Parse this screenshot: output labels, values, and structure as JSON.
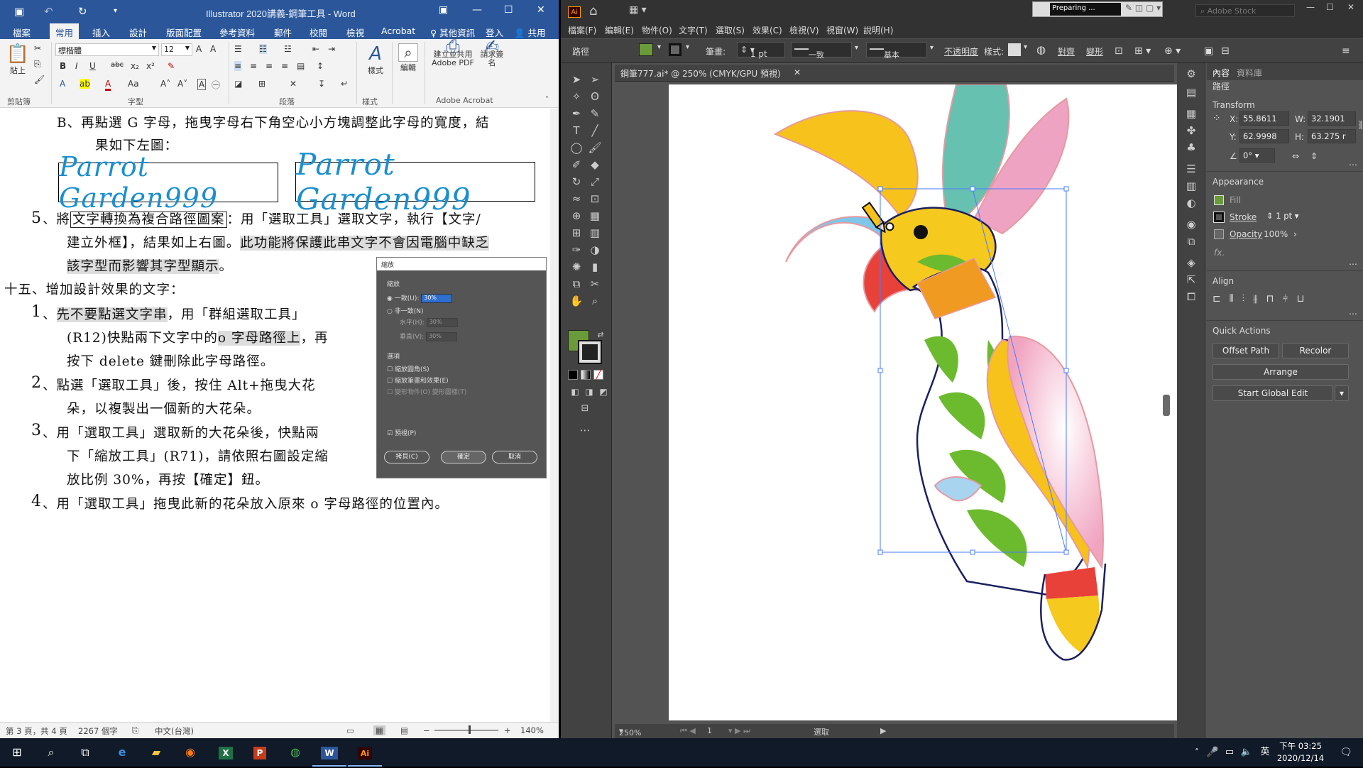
{
  "word": {
    "title": "Illustrator 2020講義-鋼筆工具 - Word",
    "tabs": [
      "檔案",
      "常用",
      "插入",
      "設計",
      "版面配置",
      "參考資料",
      "郵件",
      "校閱",
      "檢視",
      "Acrobat"
    ],
    "tell_me": "♀ 其他資訊",
    "signin": "登入",
    "share": "共用",
    "ribbon": {
      "font_name": "標楷體",
      "font_size": "12",
      "paste_label": "貼上",
      "styles_label": "樣式",
      "edit_label": "編輯",
      "pdf_label": "建立並共用 Adobe PDF",
      "sign_label": "請求簽名",
      "groups": [
        "剪貼簿",
        "字型",
        "段落",
        "樣式",
        "Adobe Acrobat"
      ]
    },
    "doc": {
      "line_b1": "B、再點選 G 字母，拖曳字母右下角空心小方塊調整此字母的寬度，結",
      "line_b2": "果如下左圖：",
      "parrot_text": "Parrot Garden999",
      "item5_num": "5",
      "item5_a": "、將",
      "item5_box": "文字轉換為複合路徑圖案",
      "item5_b": "：用「選取工具」選取文字，執行【文字/",
      "item5_l2a": "建立外框】，結果如上右圖。",
      "item5_l2b": "此功能將保護此串文字不會因電腦中缺乏",
      "item5_l3": "該字型而影響其字型顯示",
      "item5_l3end": "。",
      "sec15": "十五、增加設計效果的文字：",
      "i1_num": "1",
      "i1_a": "、",
      "i1_hl": "先不要點選文字串",
      "i1_b": "，用「群組選取工具」",
      "i1_l2a": "(R12)快點兩下文字中的",
      "i1_l2hl": "o 字母路徑上",
      "i1_l2b": "，再",
      "i1_l3": "按下 delete 鍵刪除此字母路徑。",
      "i2_num": "2",
      "i2_l1": "、點選「選取工具」後，按住 Alt+拖曳大花",
      "i2_l2": "朵，以複製出一個新的大花朵。",
      "i3_num": "3",
      "i3_l1": "、用「選取工具」選取新的大花朵後，快點兩",
      "i3_l2": "下「縮放工具」(R71)，請依照右圖設定縮",
      "i3_l3": "放比例 30%，再按【確定】鈕。",
      "i4_num": "4",
      "i4_l1": "、用「選取工具」拖曳此新的花朵放入原來 o 字母路徑的位置內。"
    },
    "dialog": {
      "title": "縮放",
      "group1": "縮放",
      "uniform": "一致(U):",
      "uniform_val": "30%",
      "nonuniform": "非一致(N)",
      "horiz": "水平(H):",
      "horiz_val": "30%",
      "vert": "垂直(V):",
      "vert_val": "30%",
      "group2": "選項",
      "opt1": "縮放圓角(S)",
      "opt2": "縮放筆畫和效果(E)",
      "opt3": "變形物件(O)   變形圖樣(T)",
      "preview": "預視(P)",
      "copy_btn": "拷貝(C)",
      "ok_btn": "確定",
      "cancel_btn": "取消"
    },
    "status": {
      "page": "第 3 頁，共 4 頁",
      "words": "2267 個字",
      "lang": "中文(台灣)",
      "zoom": "140%"
    }
  },
  "ai": {
    "search_placeholder": "Adobe Stock",
    "preparing": "Preparing ...",
    "menu": [
      "檔案(F)",
      "編輯(E)",
      "物件(O)",
      "文字(T)",
      "選取(S)",
      "效果(C)",
      "檢視(V)",
      "視窗(W)",
      "說明(H)"
    ],
    "control": {
      "path": "路徑",
      "stroke_label": "筆畫:",
      "stroke_val": "1 pt",
      "profile1": "一致",
      "profile2": "基本",
      "opacity": "不透明度",
      "style": "樣式:",
      "align": "對齊",
      "transform": "變形"
    },
    "doc_tab": "鋼筆777.ai* @ 250% (CMYK/GPU 預視)",
    "bottom": {
      "zoom": "250%",
      "page": "1",
      "mode": "選取"
    },
    "props": {
      "tab1": "內容",
      "tab2": "資料庫",
      "selection": "路徑",
      "transform": "Transform",
      "x_label": "X:",
      "x": "55.8611",
      "y_label": "Y:",
      "y": "62.9998",
      "w_label": "W:",
      "w": "32.1901",
      "h_label": "H:",
      "h": "63.275 r",
      "angle": "0°",
      "appearance": "Appearance",
      "fill": "Fill",
      "stroke": "Stroke",
      "stroke_val": "1 pt",
      "opacity": "Opacity",
      "opacity_val": "100%",
      "fx": "fx.",
      "align": "Align",
      "quick_actions": "Quick Actions",
      "offset_path": "Offset Path",
      "recolor": "Recolor",
      "arrange": "Arrange",
      "global_edit": "Start Global Edit"
    }
  },
  "taskbar": {
    "ime": "英",
    "time": "下午 03:25",
    "date": "2020/12/14"
  }
}
